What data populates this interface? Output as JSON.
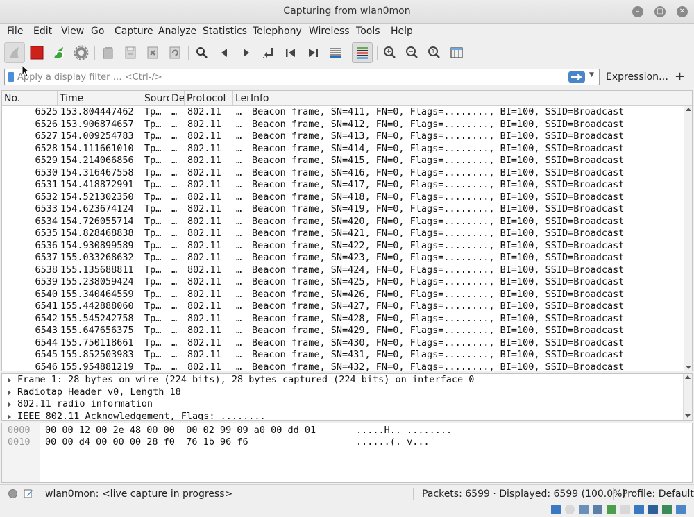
{
  "window": {
    "title": "Capturing from wlan0mon"
  },
  "menubar": [
    {
      "label": "File",
      "key": "F"
    },
    {
      "label": "Edit",
      "key": "E"
    },
    {
      "label": "View",
      "key": "V"
    },
    {
      "label": "Go",
      "key": "G"
    },
    {
      "label": "Capture",
      "key": "C"
    },
    {
      "label": "Analyze",
      "key": "A"
    },
    {
      "label": "Statistics",
      "key": "S"
    },
    {
      "label": "Telephony",
      "key": "y"
    },
    {
      "label": "Wireless",
      "key": "W"
    },
    {
      "label": "Tools",
      "key": "T"
    },
    {
      "label": "Help",
      "key": "H"
    }
  ],
  "filter": {
    "placeholder": "Apply a display filter … <Ctrl-/>",
    "value": "",
    "expression_label": "Expression…",
    "plus_label": "+"
  },
  "columns": [
    "No.",
    "Time",
    "Source",
    "Destination",
    "Protocol",
    "Length",
    "Info"
  ],
  "column_display": [
    "No.",
    "Time",
    "Sourc",
    "De",
    "Protocol",
    "Ler",
    "Info"
  ],
  "packets": [
    {
      "no": "6525",
      "time": "153.804447462",
      "src": "Tp…",
      "dst": "…",
      "proto": "802.11",
      "len": "…",
      "info": "Beacon frame, SN=411, FN=0, Flags=........, BI=100, SSID=Broadcast"
    },
    {
      "no": "6526",
      "time": "153.906874657",
      "src": "Tp…",
      "dst": "…",
      "proto": "802.11",
      "len": "…",
      "info": "Beacon frame, SN=412, FN=0, Flags=........, BI=100, SSID=Broadcast"
    },
    {
      "no": "6527",
      "time": "154.009254783",
      "src": "Tp…",
      "dst": "…",
      "proto": "802.11",
      "len": "…",
      "info": "Beacon frame, SN=413, FN=0, Flags=........, BI=100, SSID=Broadcast"
    },
    {
      "no": "6528",
      "time": "154.111661010",
      "src": "Tp…",
      "dst": "…",
      "proto": "802.11",
      "len": "…",
      "info": "Beacon frame, SN=414, FN=0, Flags=........, BI=100, SSID=Broadcast"
    },
    {
      "no": "6529",
      "time": "154.214066856",
      "src": "Tp…",
      "dst": "…",
      "proto": "802.11",
      "len": "…",
      "info": "Beacon frame, SN=415, FN=0, Flags=........, BI=100, SSID=Broadcast"
    },
    {
      "no": "6530",
      "time": "154.316467558",
      "src": "Tp…",
      "dst": "…",
      "proto": "802.11",
      "len": "…",
      "info": "Beacon frame, SN=416, FN=0, Flags=........, BI=100, SSID=Broadcast"
    },
    {
      "no": "6531",
      "time": "154.418872991",
      "src": "Tp…",
      "dst": "…",
      "proto": "802.11",
      "len": "…",
      "info": "Beacon frame, SN=417, FN=0, Flags=........, BI=100, SSID=Broadcast"
    },
    {
      "no": "6532",
      "time": "154.521302350",
      "src": "Tp…",
      "dst": "…",
      "proto": "802.11",
      "len": "…",
      "info": "Beacon frame, SN=418, FN=0, Flags=........, BI=100, SSID=Broadcast"
    },
    {
      "no": "6533",
      "time": "154.623674124",
      "src": "Tp…",
      "dst": "…",
      "proto": "802.11",
      "len": "…",
      "info": "Beacon frame, SN=419, FN=0, Flags=........, BI=100, SSID=Broadcast"
    },
    {
      "no": "6534",
      "time": "154.726055714",
      "src": "Tp…",
      "dst": "…",
      "proto": "802.11",
      "len": "…",
      "info": "Beacon frame, SN=420, FN=0, Flags=........, BI=100, SSID=Broadcast"
    },
    {
      "no": "6535",
      "time": "154.828468838",
      "src": "Tp…",
      "dst": "…",
      "proto": "802.11",
      "len": "…",
      "info": "Beacon frame, SN=421, FN=0, Flags=........, BI=100, SSID=Broadcast"
    },
    {
      "no": "6536",
      "time": "154.930899589",
      "src": "Tp…",
      "dst": "…",
      "proto": "802.11",
      "len": "…",
      "info": "Beacon frame, SN=422, FN=0, Flags=........, BI=100, SSID=Broadcast"
    },
    {
      "no": "6537",
      "time": "155.033268632",
      "src": "Tp…",
      "dst": "…",
      "proto": "802.11",
      "len": "…",
      "info": "Beacon frame, SN=423, FN=0, Flags=........, BI=100, SSID=Broadcast"
    },
    {
      "no": "6538",
      "time": "155.135688811",
      "src": "Tp…",
      "dst": "…",
      "proto": "802.11",
      "len": "…",
      "info": "Beacon frame, SN=424, FN=0, Flags=........, BI=100, SSID=Broadcast"
    },
    {
      "no": "6539",
      "time": "155.238059424",
      "src": "Tp…",
      "dst": "…",
      "proto": "802.11",
      "len": "…",
      "info": "Beacon frame, SN=425, FN=0, Flags=........, BI=100, SSID=Broadcast"
    },
    {
      "no": "6540",
      "time": "155.340464559",
      "src": "Tp…",
      "dst": "…",
      "proto": "802.11",
      "len": "…",
      "info": "Beacon frame, SN=426, FN=0, Flags=........, BI=100, SSID=Broadcast"
    },
    {
      "no": "6541",
      "time": "155.442888060",
      "src": "Tp…",
      "dst": "…",
      "proto": "802.11",
      "len": "…",
      "info": "Beacon frame, SN=427, FN=0, Flags=........, BI=100, SSID=Broadcast"
    },
    {
      "no": "6542",
      "time": "155.545242758",
      "src": "Tp…",
      "dst": "…",
      "proto": "802.11",
      "len": "…",
      "info": "Beacon frame, SN=428, FN=0, Flags=........, BI=100, SSID=Broadcast"
    },
    {
      "no": "6543",
      "time": "155.647656375",
      "src": "Tp…",
      "dst": "…",
      "proto": "802.11",
      "len": "…",
      "info": "Beacon frame, SN=429, FN=0, Flags=........, BI=100, SSID=Broadcast"
    },
    {
      "no": "6544",
      "time": "155.750118661",
      "src": "Tp…",
      "dst": "…",
      "proto": "802.11",
      "len": "…",
      "info": "Beacon frame, SN=430, FN=0, Flags=........, BI=100, SSID=Broadcast"
    },
    {
      "no": "6545",
      "time": "155.852503983",
      "src": "Tp…",
      "dst": "…",
      "proto": "802.11",
      "len": "…",
      "info": "Beacon frame, SN=431, FN=0, Flags=........, BI=100, SSID=Broadcast"
    },
    {
      "no": "6546",
      "time": "155.954881219",
      "src": "Tp…",
      "dst": "…",
      "proto": "802.11",
      "len": "…",
      "info": "Beacon frame, SN=432, FN=0, Flags=........, BI=100, SSID=Broadcast"
    }
  ],
  "details": [
    "Frame 1: 28 bytes on wire (224 bits), 28 bytes captured (224 bits) on interface 0",
    "Radiotap Header v0, Length 18",
    "802.11 radio information",
    "IEEE 802.11 Acknowledgement, Flags: ........"
  ],
  "bytes": [
    {
      "offset": "0000",
      "hex": "00 00 12 00 2e 48 00 00  00 02 99 09 a0 00 dd 01",
      "ascii": ".....H.. ........"
    },
    {
      "offset": "0010",
      "hex": "00 00 d4 00 00 00 28 f0  76 1b 96 f6",
      "ascii": "......(. v..."
    }
  ],
  "status": {
    "capture_text": "wlan0mon: <live capture in progress>",
    "packets_text": "Packets: 6599 · Displayed: 6599 (100.0%)",
    "profile_text": "Profile: Default"
  },
  "toolbar": {
    "icons": [
      "shark-fin-start-icon",
      "stop-capture-icon",
      "restart-capture-icon",
      "capture-options-icon",
      "open-file-icon",
      "save-file-icon",
      "close-file-icon",
      "reload-file-icon",
      "find-packet-icon",
      "go-back-icon",
      "go-forward-icon",
      "go-to-packet-icon",
      "first-packet-icon",
      "last-packet-icon",
      "autoscroll-icon",
      "colorize-icon",
      "zoom-in-icon",
      "zoom-out-icon",
      "normal-size-icon",
      "resize-columns-icon"
    ]
  },
  "colors": {
    "stop_red": "#d0201c",
    "restart_green": "#3aa63a",
    "accent_blue": "#4a86c8"
  }
}
